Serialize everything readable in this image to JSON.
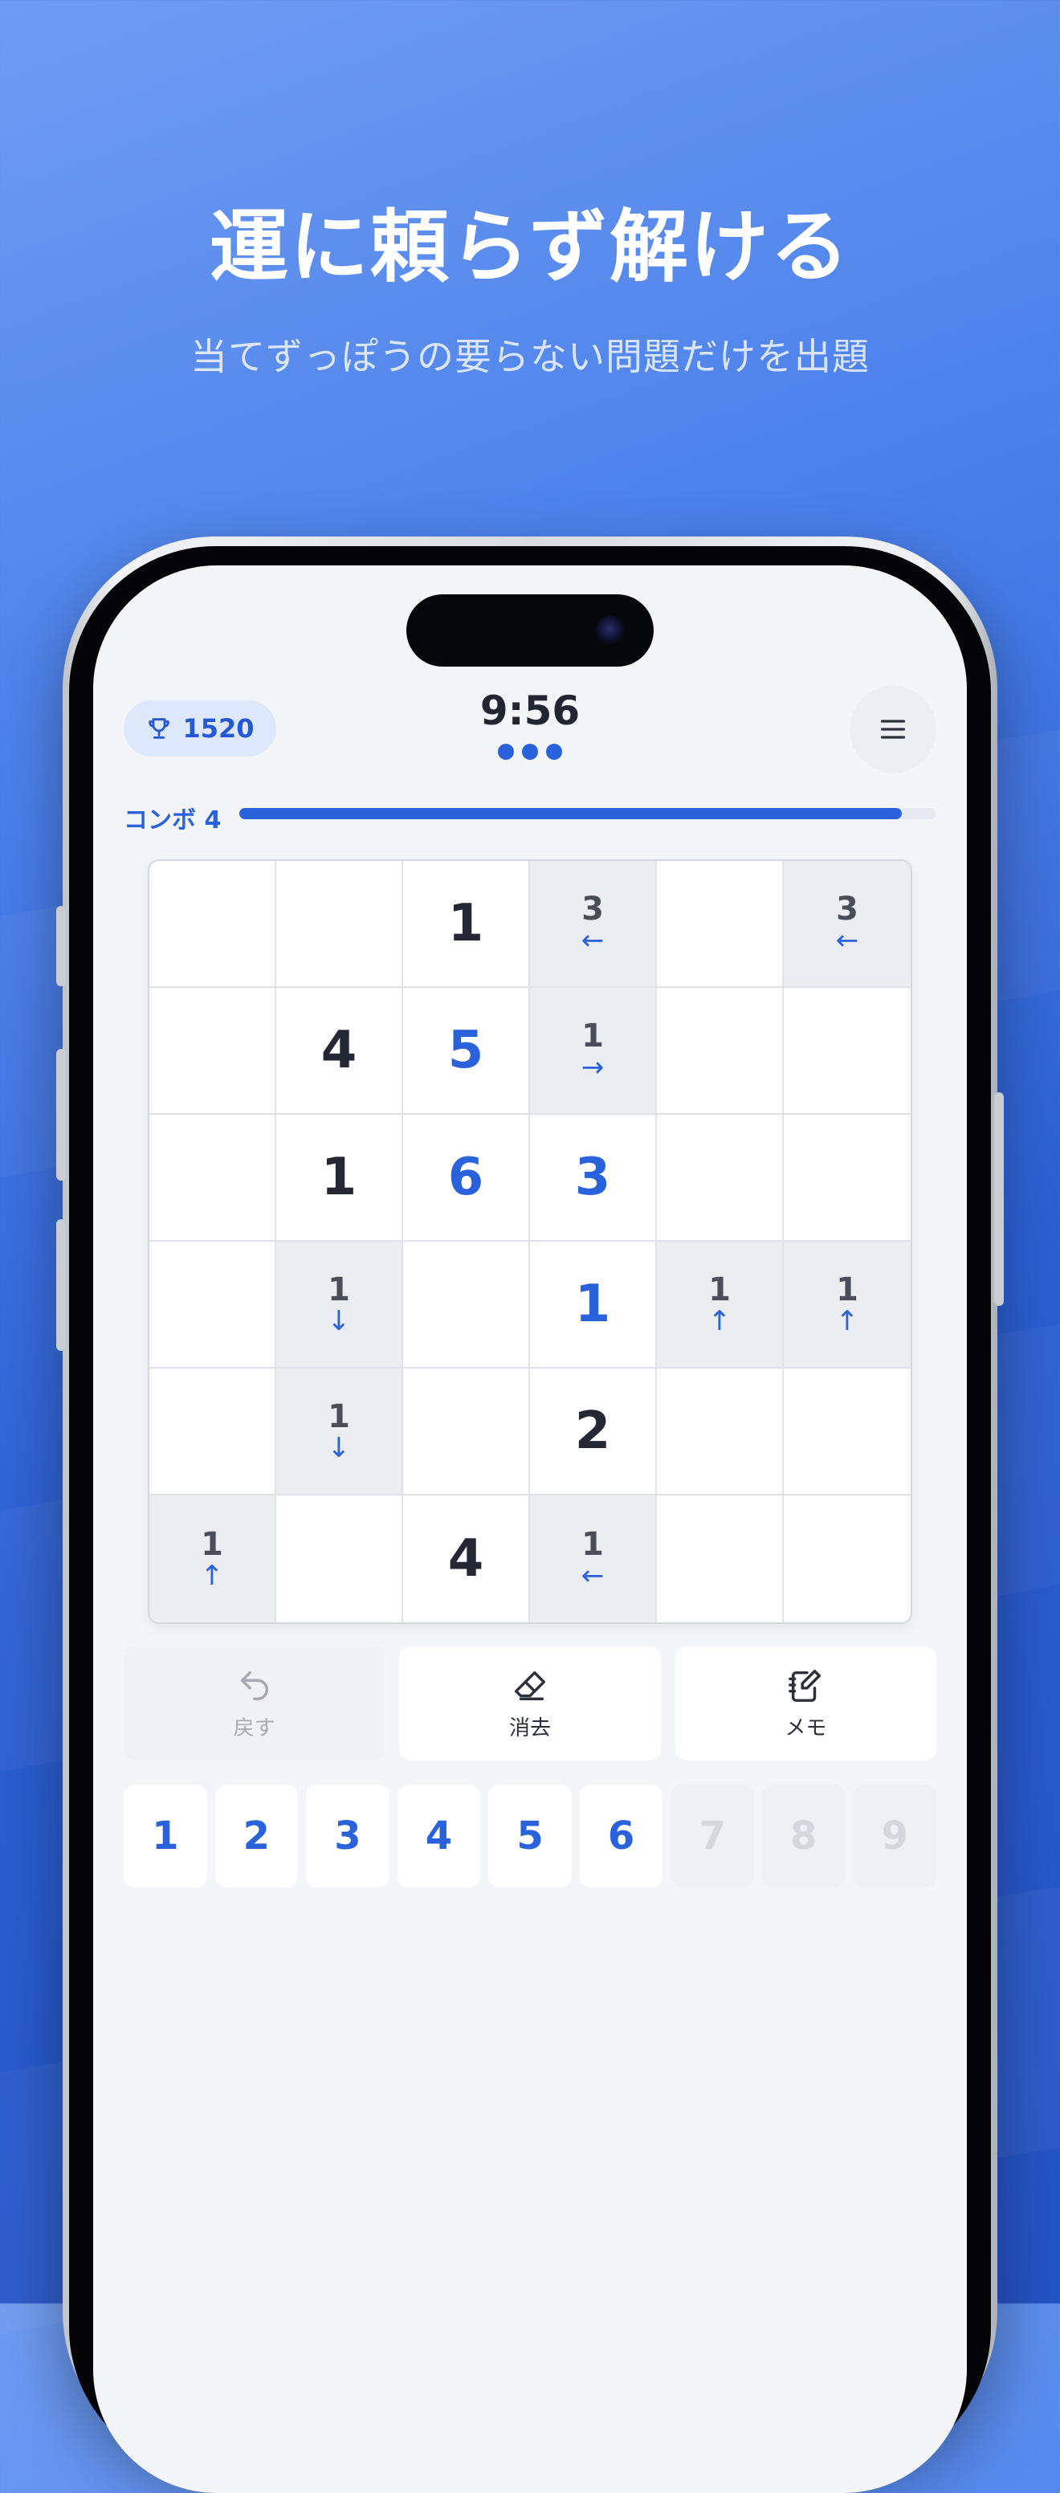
{
  "promo": {
    "headline": "運に頼らず解ける",
    "subline": "当てずっぽうの要らない問題だけを出題"
  },
  "header": {
    "rating": "1520",
    "timer": "9:56",
    "progress_dots": 3
  },
  "combo": {
    "label": "コンボ 4",
    "fill_fraction": 0.95
  },
  "grid": {
    "rows": [
      [
        {
          "t": "empty"
        },
        {
          "t": "empty"
        },
        {
          "t": "given",
          "v": "1"
        },
        {
          "t": "hint",
          "v": "3",
          "a": "←"
        },
        {
          "t": "empty"
        },
        {
          "t": "hint",
          "v": "3",
          "a": "←"
        }
      ],
      [
        {
          "t": "empty"
        },
        {
          "t": "given",
          "v": "4"
        },
        {
          "t": "entered",
          "v": "5"
        },
        {
          "t": "hint",
          "v": "1",
          "a": "→"
        },
        {
          "t": "empty"
        },
        {
          "t": "empty"
        }
      ],
      [
        {
          "t": "empty"
        },
        {
          "t": "given",
          "v": "1"
        },
        {
          "t": "entered",
          "v": "6"
        },
        {
          "t": "entered",
          "v": "3"
        },
        {
          "t": "empty"
        },
        {
          "t": "empty"
        }
      ],
      [
        {
          "t": "empty"
        },
        {
          "t": "hint",
          "v": "1",
          "a": "↓"
        },
        {
          "t": "empty"
        },
        {
          "t": "entered",
          "v": "1"
        },
        {
          "t": "hint",
          "v": "1",
          "a": "↑"
        },
        {
          "t": "hint",
          "v": "1",
          "a": "↑"
        }
      ],
      [
        {
          "t": "empty"
        },
        {
          "t": "hint",
          "v": "1",
          "a": "↓"
        },
        {
          "t": "empty"
        },
        {
          "t": "given",
          "v": "2"
        },
        {
          "t": "empty"
        },
        {
          "t": "empty"
        }
      ],
      [
        {
          "t": "hint",
          "v": "1",
          "a": "↑"
        },
        {
          "t": "empty"
        },
        {
          "t": "given",
          "v": "4"
        },
        {
          "t": "hint",
          "v": "1",
          "a": "←"
        },
        {
          "t": "empty"
        },
        {
          "t": "empty"
        }
      ]
    ]
  },
  "actions": {
    "undo_label": "戻す",
    "erase_label": "消去",
    "memo_label": "メモ"
  },
  "numpad": {
    "keys": [
      {
        "label": "1",
        "enabled": true
      },
      {
        "label": "2",
        "enabled": true
      },
      {
        "label": "3",
        "enabled": true
      },
      {
        "label": "4",
        "enabled": true
      },
      {
        "label": "5",
        "enabled": true
      },
      {
        "label": "6",
        "enabled": true
      },
      {
        "label": "7",
        "enabled": false
      },
      {
        "label": "8",
        "enabled": false
      },
      {
        "label": "9",
        "enabled": false
      }
    ]
  },
  "icons": {
    "rating": "trophy-icon",
    "menu": "hamburger-menu-icon",
    "undo": "undo-arrow-icon",
    "erase": "eraser-icon",
    "memo": "notebook-pencil-icon"
  },
  "colors": {
    "accent": "#2a62dc",
    "background_top": "#6f9cf2",
    "background_bottom": "#2453c4",
    "hint_cell": "#ecedf1"
  }
}
